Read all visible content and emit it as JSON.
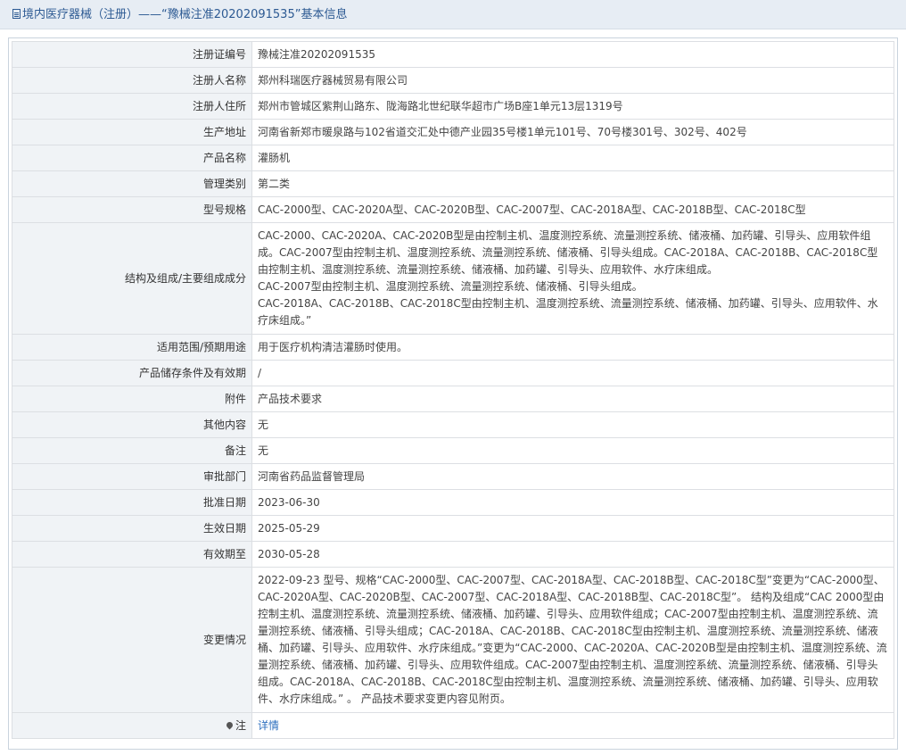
{
  "header": {
    "title": "境内医疗器械（注册）——“豫械注准20202091535”基本信息"
  },
  "rows": [
    {
      "key": "注册证编号",
      "value": "豫械注准20202091535"
    },
    {
      "key": "注册人名称",
      "value": "郑州科瑞医疗器械贸易有限公司"
    },
    {
      "key": "注册人住所",
      "value": "郑州市管城区紫荆山路东、陇海路北世纪联华超市广场B座1单元13层1319号"
    },
    {
      "key": "生产地址",
      "value": "河南省新郑市暖泉路与102省道交汇处中德产业园35号楼1单元101号、70号楼301号、302号、402号"
    },
    {
      "key": "产品名称",
      "value": "灌肠机"
    },
    {
      "key": "管理类别",
      "value": "第二类"
    },
    {
      "key": "型号规格",
      "value": "CAC-2000型、CAC-2020A型、CAC-2020B型、CAC-2007型、CAC-2018A型、CAC-2018B型、CAC-2018C型"
    }
  ],
  "structure": {
    "key": "结构及组成/主要组成成分",
    "lines": [
      "CAC-2000、CAC-2020A、CAC-2020B型是由控制主机、温度测控系统、流量测控系统、储液桶、加药罐、引导头、应用软件组成。CAC-2007型由控制主机、温度测控系统、流量测控系统、储液桶、引导头组成。CAC-2018A、CAC-2018B、CAC-2018C型由控制主机、温度测控系统、流量测控系统、储液桶、加药罐、引导头、应用软件、水疗床组成。",
      "CAC-2007型由控制主机、温度测控系统、流量测控系统、储液桶、引导头组成。",
      "CAC-2018A、CAC-2018B、CAC-2018C型由控制主机、温度测控系统、流量测控系统、储液桶、加药罐、引导头、应用软件、水疗床组成。”"
    ]
  },
  "rows2": [
    {
      "key": "适用范围/预期用途",
      "value": "用于医疗机构清洁灌肠时使用。"
    },
    {
      "key": "产品储存条件及有效期",
      "value": "/"
    },
    {
      "key": "附件",
      "value": "产品技术要求"
    },
    {
      "key": "其他内容",
      "value": "无"
    },
    {
      "key": "备注",
      "value": "无"
    },
    {
      "key": "审批部门",
      "value": "河南省药品监督管理局"
    },
    {
      "key": "批准日期",
      "value": "2023-06-30"
    },
    {
      "key": "生效日期",
      "value": "2025-05-29"
    },
    {
      "key": "有效期至",
      "value": "2030-05-28"
    }
  ],
  "changes": {
    "key": "变更情况",
    "value": "2022-09-23 型号、规格“CAC-2000型、CAC-2007型、CAC-2018A型、CAC-2018B型、CAC-2018C型”变更为“CAC-2000型、CAC-2020A型、CAC-2020B型、CAC-2007型、CAC-2018A型、CAC-2018B型、CAC-2018C型”。 结构及组成“CAC 2000型由控制主机、温度测控系统、流量测控系统、储液桶、加药罐、引导头、应用软件组成；CAC-2007型由控制主机、温度测控系统、流量测控系统、储液桶、引导头组成；CAC-2018A、CAC-2018B、CAC-2018C型由控制主机、温度测控系统、流量测控系统、储液桶、加药罐、引导头、应用软件、水疗床组成。”变更为“CAC-2000、CAC-2020A、CAC-2020B型是由控制主机、温度测控系统、流量测控系统、储液桶、加药罐、引导头、应用软件组成。CAC-2007型由控制主机、温度测控系统、流量测控系统、储液桶、引导头组成。CAC-2018A、CAC-2018B、CAC-2018C型由控制主机、温度测控系统、流量测控系统、储液桶、加药罐、引导头、应用软件、水疗床组成。” 。 产品技术要求变更内容见附页。"
  },
  "note": {
    "key": "注",
    "link_label": "详情"
  }
}
